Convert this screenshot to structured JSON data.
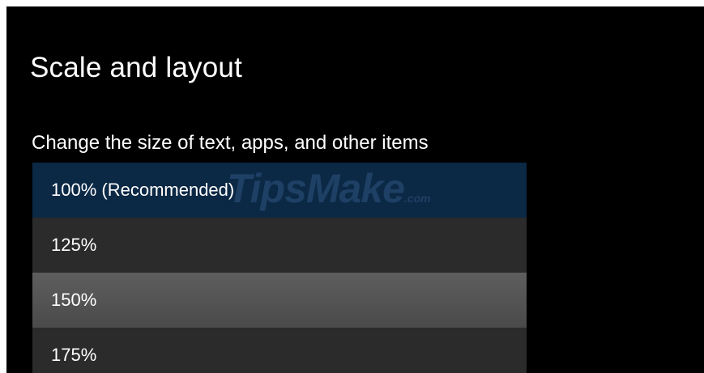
{
  "section": {
    "title": "Scale and layout"
  },
  "scale_setting": {
    "label": "Change the size of text, apps, and other items",
    "options": [
      {
        "label": "100% (Recommended)"
      },
      {
        "label": "125%"
      },
      {
        "label": "150%"
      },
      {
        "label": "175%"
      }
    ],
    "selected": "100% (Recommended)"
  },
  "watermark": {
    "text": "TipsMake",
    "tld": ".com"
  },
  "colors": {
    "background": "#000000",
    "text": "#ffffff",
    "selected_option": "#0b2845",
    "option": "#2b2b2b",
    "hovered_option": "#555555"
  }
}
